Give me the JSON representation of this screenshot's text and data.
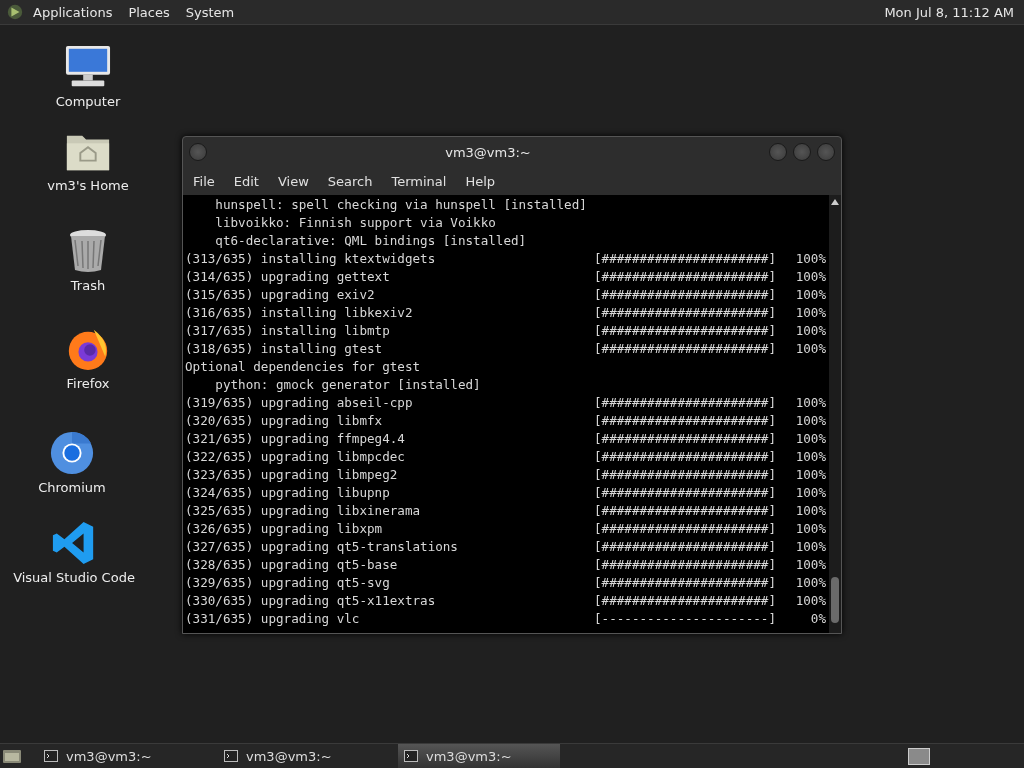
{
  "top_panel": {
    "menus": [
      "Applications",
      "Places",
      "System"
    ],
    "clock": "Mon Jul  8, 11:12 AM"
  },
  "desktop_icons": [
    {
      "kind": "computer",
      "label": "Computer"
    },
    {
      "kind": "home",
      "label": "vm3's Home"
    },
    {
      "kind": "trash",
      "label": "Trash"
    },
    {
      "kind": "firefox",
      "label": "Firefox"
    },
    {
      "kind": "chromium",
      "label": "Chromium"
    },
    {
      "kind": "vscode",
      "label": "Visual Studio Code"
    }
  ],
  "terminal": {
    "title": "vm3@vm3:~",
    "menus": [
      "File",
      "Edit",
      "View",
      "Search",
      "Terminal",
      "Help"
    ],
    "lines": [
      {
        "kind": "text",
        "text": "    hunspell: spell checking via hunspell [installed]"
      },
      {
        "kind": "text",
        "text": "    libvoikko: Finnish support via Voikko"
      },
      {
        "kind": "text",
        "text": "    qt6-declarative: QML bindings [installed]"
      },
      {
        "kind": "progress",
        "text": "(313/635) installing ktextwidgets",
        "bar": "[######################]",
        "percent": "100%"
      },
      {
        "kind": "progress",
        "text": "(314/635) upgrading gettext",
        "bar": "[######################]",
        "percent": "100%"
      },
      {
        "kind": "progress",
        "text": "(315/635) upgrading exiv2",
        "bar": "[######################]",
        "percent": "100%"
      },
      {
        "kind": "progress",
        "text": "(316/635) installing libkexiv2",
        "bar": "[######################]",
        "percent": "100%"
      },
      {
        "kind": "progress",
        "text": "(317/635) installing libmtp",
        "bar": "[######################]",
        "percent": "100%"
      },
      {
        "kind": "progress",
        "text": "(318/635) installing gtest",
        "bar": "[######################]",
        "percent": "100%"
      },
      {
        "kind": "text",
        "text": "Optional dependencies for gtest"
      },
      {
        "kind": "text",
        "text": "    python: gmock generator [installed]"
      },
      {
        "kind": "progress",
        "text": "(319/635) upgrading abseil-cpp",
        "bar": "[######################]",
        "percent": "100%"
      },
      {
        "kind": "progress",
        "text": "(320/635) upgrading libmfx",
        "bar": "[######################]",
        "percent": "100%"
      },
      {
        "kind": "progress",
        "text": "(321/635) upgrading ffmpeg4.4",
        "bar": "[######################]",
        "percent": "100%"
      },
      {
        "kind": "progress",
        "text": "(322/635) upgrading libmpcdec",
        "bar": "[######################]",
        "percent": "100%"
      },
      {
        "kind": "progress",
        "text": "(323/635) upgrading libmpeg2",
        "bar": "[######################]",
        "percent": "100%"
      },
      {
        "kind": "progress",
        "text": "(324/635) upgrading libupnp",
        "bar": "[######################]",
        "percent": "100%"
      },
      {
        "kind": "progress",
        "text": "(325/635) upgrading libxinerama",
        "bar": "[######################]",
        "percent": "100%"
      },
      {
        "kind": "progress",
        "text": "(326/635) upgrading libxpm",
        "bar": "[######################]",
        "percent": "100%"
      },
      {
        "kind": "progress",
        "text": "(327/635) upgrading qt5-translations",
        "bar": "[######################]",
        "percent": "100%"
      },
      {
        "kind": "progress",
        "text": "(328/635) upgrading qt5-base",
        "bar": "[######################]",
        "percent": "100%"
      },
      {
        "kind": "progress",
        "text": "(329/635) upgrading qt5-svg",
        "bar": "[######################]",
        "percent": "100%"
      },
      {
        "kind": "progress",
        "text": "(330/635) upgrading qt5-x11extras",
        "bar": "[######################]",
        "percent": "100%"
      },
      {
        "kind": "progress",
        "text": "(331/635) upgrading vlc",
        "bar": "[----------------------]",
        "percent": "0%"
      }
    ]
  },
  "taskbar": [
    {
      "label": "vm3@vm3:~",
      "selected": false
    },
    {
      "label": "vm3@vm3:~",
      "selected": false
    },
    {
      "label": "vm3@vm3:~",
      "selected": true
    }
  ]
}
